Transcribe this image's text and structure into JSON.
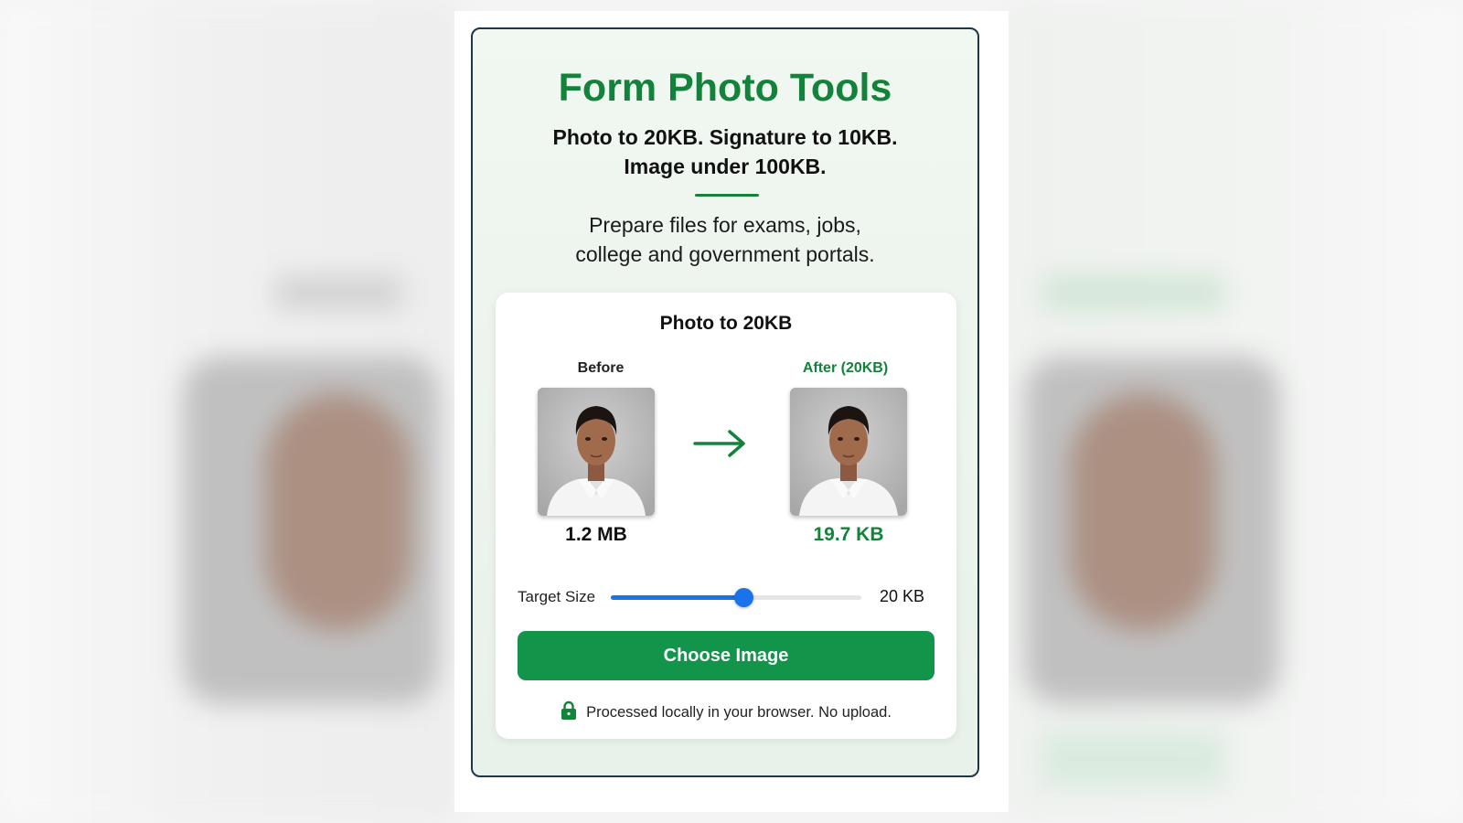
{
  "header": {
    "title": "Form Photo Tools",
    "subtitle_line1": "Photo to 20KB. Signature to 10KB.",
    "subtitle_line2": "Image under 100KB.",
    "description_line1": "Prepare files for exams, jobs,",
    "description_line2": "college and government portals."
  },
  "tool": {
    "title": "Photo to 20KB",
    "before_label": "Before",
    "after_label": "After (20KB)",
    "before_size": "1.2 MB",
    "after_size": "19.7 KB",
    "target_label": "Target Size",
    "target_value": "20 KB",
    "slider_fraction": 0.53,
    "choose_button": "Choose Image",
    "privacy_note": "Processed locally in your browser. No upload."
  },
  "icons": {
    "arrow": "arrow-right-icon",
    "lock": "lock-icon"
  },
  "colors": {
    "brand_green": "#13833b",
    "button_green": "#12954a",
    "slider_blue": "#1a73e8",
    "card_border": "#1f3548"
  }
}
